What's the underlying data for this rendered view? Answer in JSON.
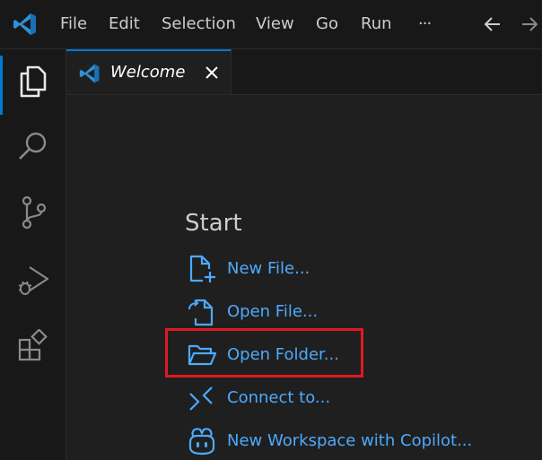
{
  "menubar": {
    "items": [
      "File",
      "Edit",
      "Selection",
      "View",
      "Go",
      "Run",
      "···"
    ]
  },
  "activity_bar": {
    "items": [
      "explorer-icon",
      "search-icon",
      "source-control-icon",
      "run-debug-icon",
      "extensions-icon"
    ],
    "active": "explorer-icon"
  },
  "tabs": [
    {
      "label": "Welcome",
      "icon": "vscode-logo-icon",
      "active": true
    }
  ],
  "welcome": {
    "start_title": "Start",
    "actions": [
      {
        "label": "New File...",
        "icon": "new-file-icon"
      },
      {
        "label": "Open File...",
        "icon": "open-file-icon"
      },
      {
        "label": "Open Folder...",
        "icon": "open-folder-icon",
        "highlighted": true
      },
      {
        "label": "Connect to...",
        "icon": "remote-connect-icon"
      },
      {
        "label": "New Workspace with Copilot...",
        "icon": "copilot-icon"
      }
    ]
  },
  "colors": {
    "background": "#1f1f1f",
    "bar_background": "#181818",
    "accent": "#0078d4",
    "link": "#4daafc",
    "highlight": "#e01a22"
  }
}
